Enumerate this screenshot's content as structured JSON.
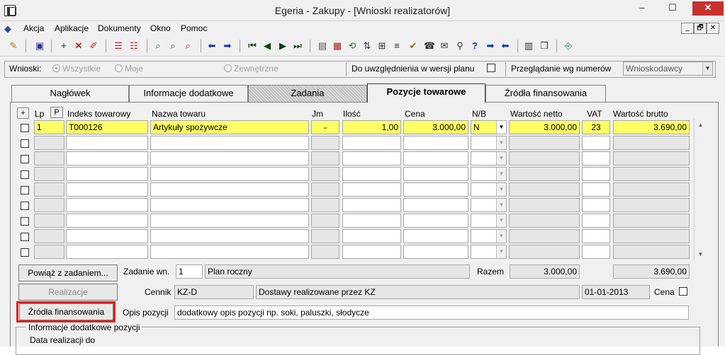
{
  "window": {
    "title": "Egeria - Zakupy - [Wnioski realizatorów]",
    "controls": [
      "–",
      "☐",
      "✕"
    ]
  },
  "menu": [
    "Akcja",
    "Aplikacje",
    "Dokumenty",
    "Okno",
    "Pomoc"
  ],
  "mdi_controls": [
    "_",
    "🗗",
    "✕"
  ],
  "filter": {
    "label": "Wnioski:",
    "radio_all": "Wszystkie",
    "radio_mine": "Moje",
    "radio_external": "Zewnętrzne",
    "include_label": "Do uwzględnienia w wersji planu",
    "browse_label": "Przeglądanie wg numerów",
    "browse_value": "Wnioskodawcy"
  },
  "tabs": [
    "Nagłówek",
    "Informacje dodatkowe",
    "Zadania",
    "Pozycje towarowe",
    "Źródła finansowania"
  ],
  "table": {
    "plus": "+",
    "headers": {
      "lp": "Lp",
      "p": "P",
      "index": "Indeks towarowy",
      "name": "Nazwa towaru",
      "jm": "Jm",
      "qty": "Ilość",
      "price": "Cena",
      "nb": "N/B",
      "net": "Wartość netto",
      "vat": "VAT",
      "gross": "Wartość brutto"
    },
    "row1": {
      "lp": "1",
      "index": "T000126",
      "name": "Artykuły spożywcze",
      "jm": "-",
      "qty": "1,00",
      "price": "3.000,00",
      "nb": "N",
      "net": "3.000,00",
      "vat": "23",
      "gross": "3.690,00"
    }
  },
  "bottom": {
    "link_task_btn": "Powiąż z zadaniem...",
    "task_label": "Zadanie wn.",
    "task_no": "1",
    "task_name": "Plan roczny",
    "total_label": "Razem",
    "total_net": "3.000,00",
    "total_gross": "3.690,00",
    "realization_btn": "Realizacje",
    "pricelist_label": "Cennik",
    "pricelist_code": "KZ-D",
    "pricelist_name": "Dostawy realizowane przez KZ",
    "pricelist_date": "01-01-2013",
    "price_chk_label": "Cena",
    "sources_btn": "Źródła finansowania",
    "desc_label": "Opis pozycji",
    "desc_value": "dodatkowy opis pozycji np. soki, paluszki, słodycze",
    "group_title": "Informacje dodatkowe pozycji",
    "date_label": "Data realizacji do"
  }
}
